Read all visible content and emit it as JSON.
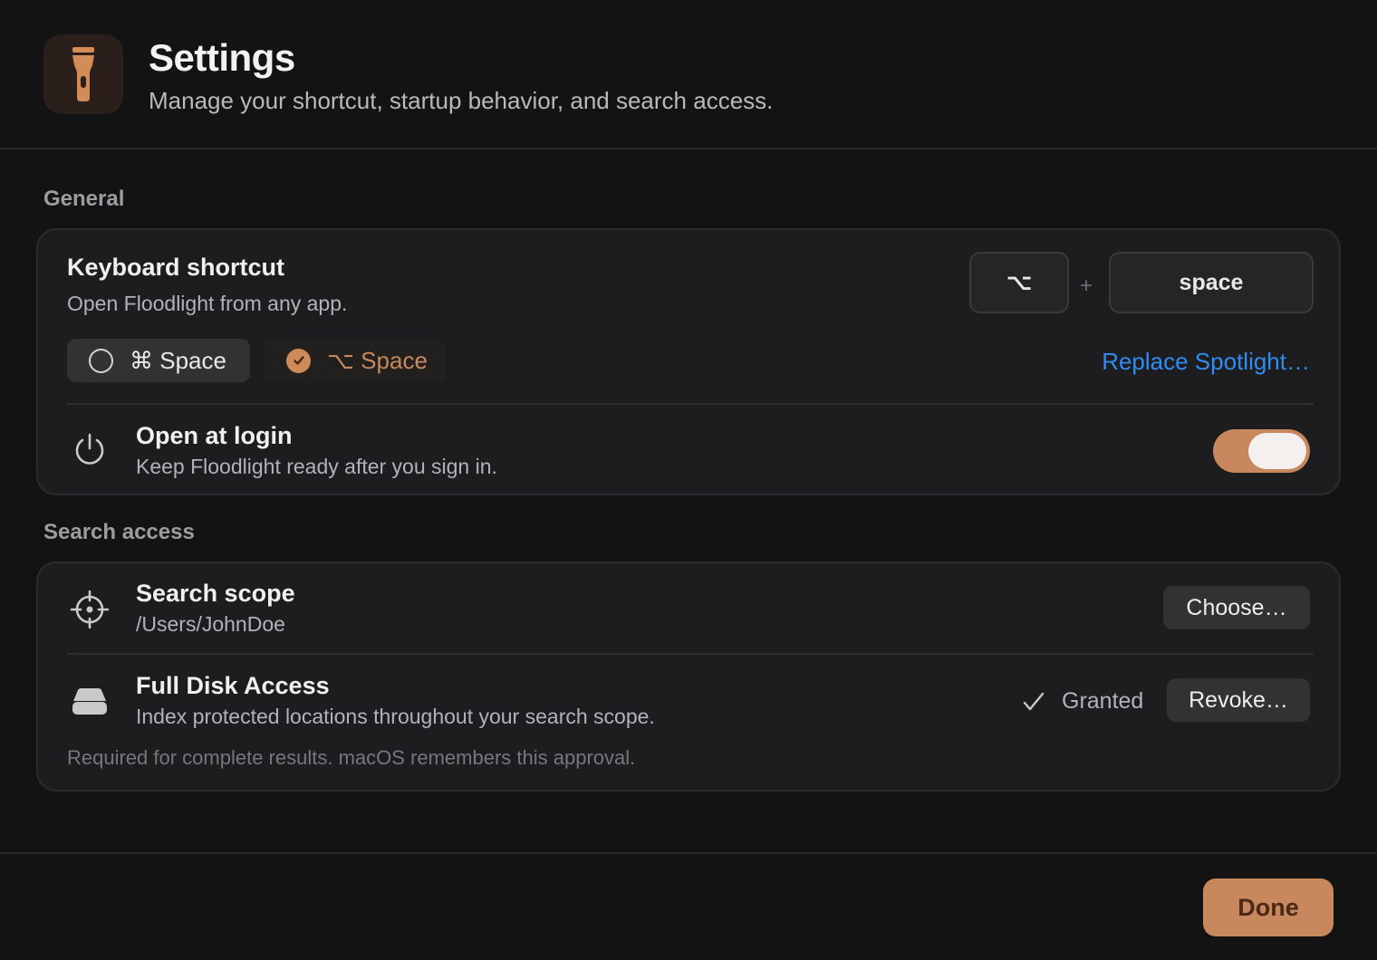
{
  "window": {
    "title": "Settings",
    "subtitle": "Manage your shortcut, startup behavior, and search access.",
    "app_icon": "flashlight-icon",
    "accent_color": "#c8875c",
    "link_color": "#2f8cf2"
  },
  "general": {
    "section_label": "General",
    "keyboard_shortcut": {
      "title": "Keyboard shortcut",
      "subtitle": "Open Floodlight from any app.",
      "keys": [
        "⌥",
        "space"
      ],
      "plus": "+",
      "options": [
        {
          "label": "⌘ Space",
          "selected": false
        },
        {
          "label": "⌥ Space",
          "selected": true
        }
      ],
      "replace_link": "Replace Spotlight…"
    },
    "open_at_login": {
      "title": "Open at login",
      "subtitle": "Keep Floodlight ready after you sign in.",
      "icon": "power-icon",
      "enabled": true
    }
  },
  "search_access": {
    "section_label": "Search access",
    "search_scope": {
      "title": "Search scope",
      "path": "/Users/JohnDoe",
      "icon": "crosshair-icon",
      "button": "Choose…"
    },
    "full_disk_access": {
      "title": "Full Disk Access",
      "subtitle": "Index protected locations throughout your search scope.",
      "icon": "drive-icon",
      "status": "Granted",
      "button": "Revoke…",
      "footnote": "Required for complete results. macOS remembers this approval."
    }
  },
  "footer": {
    "done_label": "Done"
  }
}
